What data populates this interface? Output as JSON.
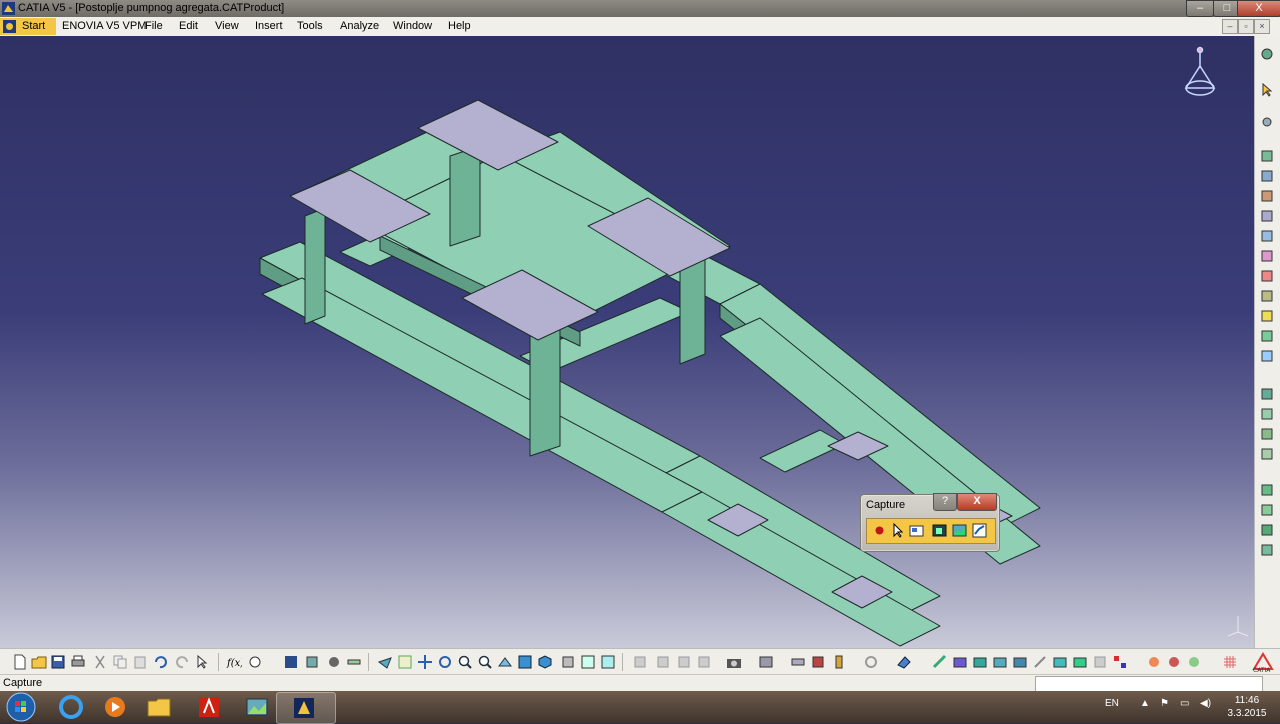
{
  "window": {
    "title": "CATIA V5 - [Postoplje pumpnog agregata.CATProduct]",
    "minimize": "–",
    "maximize": "□",
    "close": "X"
  },
  "menubar": {
    "start": "Start",
    "items": [
      "ENOVIA V5 VPM",
      "File",
      "Edit",
      "View",
      "Insert",
      "Tools",
      "Analyze",
      "Window",
      "Help"
    ]
  },
  "capture_toolbar": {
    "title": "Capture",
    "help": "?",
    "close": "X",
    "tools": [
      "record-icon",
      "select-icon",
      "capture-mode-icon",
      "shaded-capture-icon",
      "image-album-icon",
      "options-icon"
    ]
  },
  "statusbar": {
    "text": "Capture"
  },
  "taskbar": {
    "language": "EN",
    "time": "11:46",
    "date": "3.3.2015"
  },
  "colors": {
    "frame": "#8fd0b4",
    "frame_dark": "#5f9e84",
    "plates": "#b4b0cf",
    "viewport_top": "#2f3164",
    "accent": "#f3c646"
  }
}
